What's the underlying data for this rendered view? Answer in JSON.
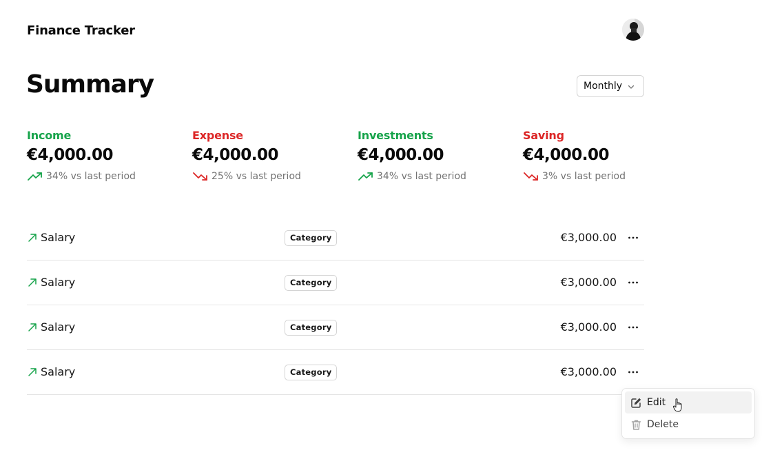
{
  "header": {
    "app_title": "Finance Tracker"
  },
  "page": {
    "title": "Summary",
    "period_select": {
      "value": "Monthly"
    }
  },
  "colors": {
    "positive": "#16a34a",
    "negative": "#dc2626",
    "muted": "#737373"
  },
  "stats": [
    {
      "label": "Income",
      "value": "€4,000.00",
      "change": "34% vs last period",
      "trend": "up"
    },
    {
      "label": "Expense",
      "value": "€4,000.00",
      "change": "25% vs last period",
      "trend": "down"
    },
    {
      "label": "Investments",
      "value": "€4,000.00",
      "change": "34% vs last period",
      "trend": "up"
    },
    {
      "label": "Saving",
      "value": "€4,000.00",
      "change": "3% vs last period",
      "trend": "down"
    }
  ],
  "transactions": [
    {
      "name": "Salary",
      "category": "Category",
      "amount": "€3,000.00",
      "icon": "arrow-up-right-icon"
    },
    {
      "name": "Salary",
      "category": "Category",
      "amount": "€3,000.00",
      "icon": "arrow-up-right-icon"
    },
    {
      "name": "Salary",
      "category": "Category",
      "amount": "€3,000.00",
      "icon": "arrow-up-right-icon"
    },
    {
      "name": "Salary",
      "category": "Category",
      "amount": "€3,000.00",
      "icon": "arrow-up-right-icon"
    }
  ],
  "context_menu": {
    "items": [
      {
        "label": "Edit",
        "icon": "edit-icon"
      },
      {
        "label": "Delete",
        "icon": "trash-icon"
      }
    ]
  }
}
